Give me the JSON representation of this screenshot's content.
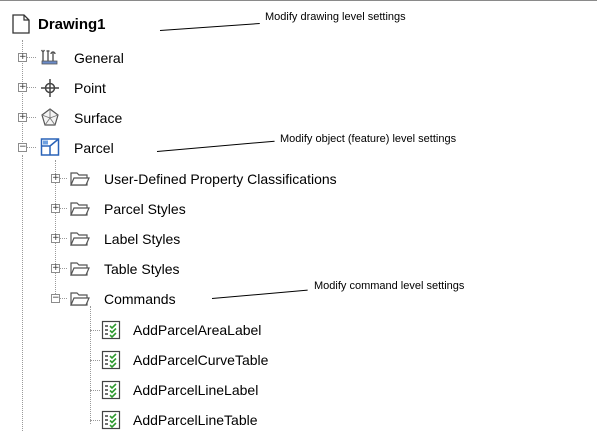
{
  "tree": {
    "root": {
      "label": "Drawing1",
      "icon": "document-icon"
    },
    "nodes": [
      {
        "label": "General",
        "icon": "general-settings-icon",
        "expander": "+"
      },
      {
        "label": "Point",
        "icon": "point-icon",
        "expander": "+"
      },
      {
        "label": "Surface",
        "icon": "surface-icon",
        "expander": "+"
      },
      {
        "label": "Parcel",
        "icon": "parcel-icon",
        "expander": "−"
      }
    ],
    "parcel_children": [
      {
        "label": "User-Defined Property Classifications",
        "icon": "folder-icon",
        "expander": "+"
      },
      {
        "label": "Parcel Styles",
        "icon": "folder-icon",
        "expander": "+"
      },
      {
        "label": "Label Styles",
        "icon": "folder-icon",
        "expander": "+"
      },
      {
        "label": "Table Styles",
        "icon": "folder-icon",
        "expander": "+"
      },
      {
        "label": "Commands",
        "icon": "folder-icon",
        "expander": "−"
      }
    ],
    "commands": [
      {
        "label": "AddParcelAreaLabel",
        "icon": "command-icon"
      },
      {
        "label": "AddParcelCurveTable",
        "icon": "command-icon"
      },
      {
        "label": "AddParcelLineLabel",
        "icon": "command-icon"
      },
      {
        "label": "AddParcelLineTable",
        "icon": "command-icon"
      }
    ]
  },
  "annotations": {
    "drawing": "Modify drawing level settings",
    "object": "Modify object (feature) level settings",
    "command": "Modify command level settings"
  },
  "colors": {
    "tree_line": "#9a9a9a",
    "folder_outline": "#555555",
    "command_green": "#2f9a2f",
    "parcel_blue": "#2a63b8"
  }
}
